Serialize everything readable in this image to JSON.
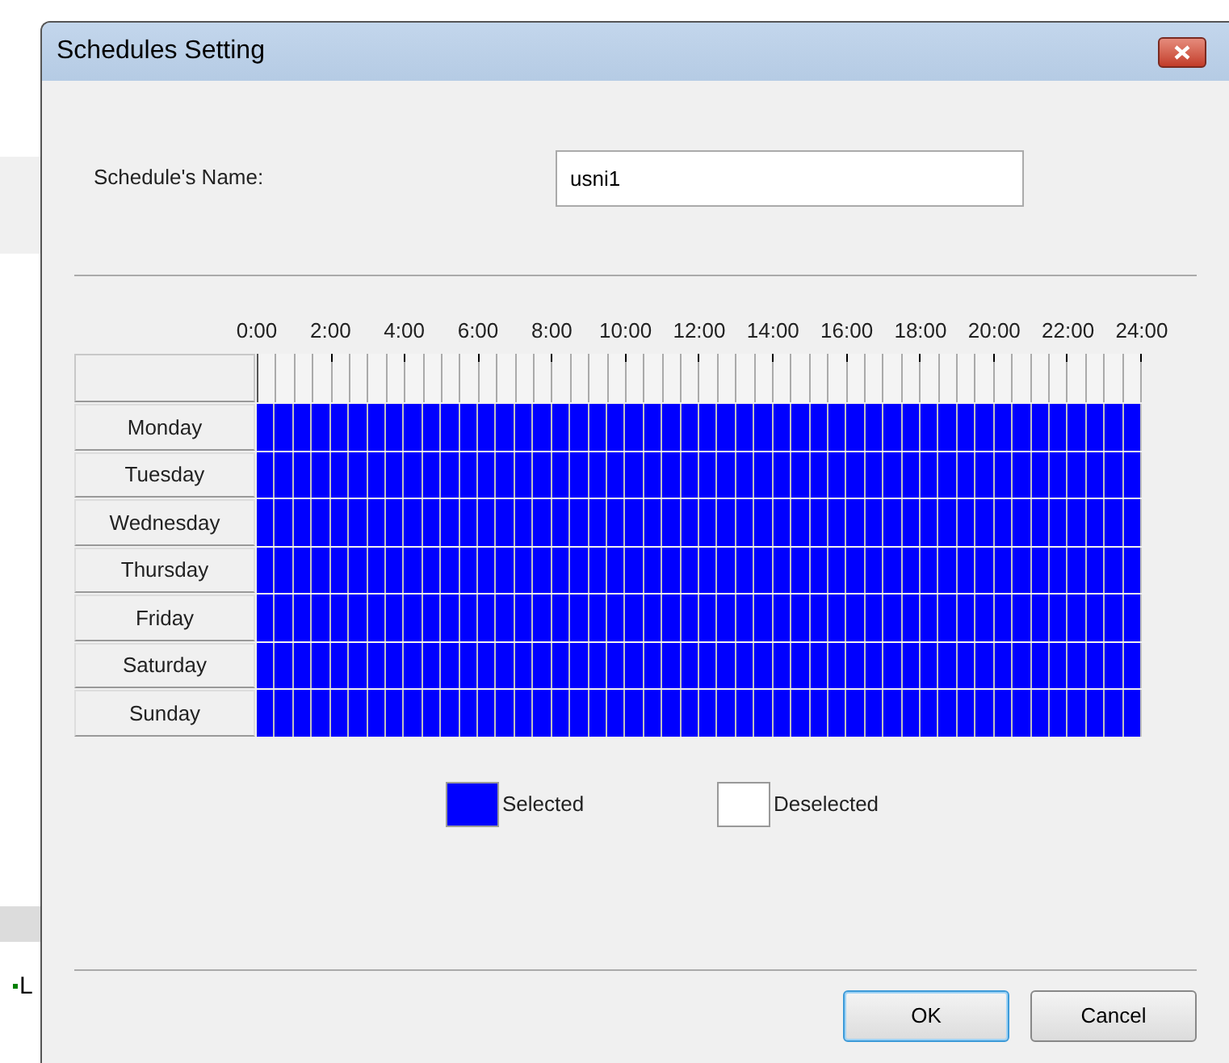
{
  "background": {
    "fragment": "L"
  },
  "window": {
    "title": "Schedules Setting"
  },
  "name_field": {
    "label": "Schedule's Name:",
    "value": "usni1"
  },
  "hours": [
    "0:00",
    "2:00",
    "4:00",
    "6:00",
    "8:00",
    "10:00",
    "12:00",
    "14:00",
    "16:00",
    "18:00",
    "20:00",
    "22:00",
    "24:00"
  ],
  "days": [
    {
      "label": "Monday",
      "slots": [
        true,
        true,
        true,
        true,
        true,
        true,
        true,
        true,
        true,
        true,
        true,
        true,
        true,
        true,
        true,
        true,
        true,
        true,
        true,
        true,
        true,
        true,
        true,
        true,
        true,
        true,
        true,
        true,
        true,
        true,
        true,
        true,
        true,
        true,
        true,
        true,
        true,
        true,
        true,
        true,
        true,
        true,
        true,
        true,
        true,
        true,
        true,
        true
      ]
    },
    {
      "label": "Tuesday",
      "slots": [
        true,
        true,
        true,
        true,
        true,
        true,
        true,
        true,
        true,
        true,
        true,
        true,
        true,
        true,
        true,
        true,
        true,
        true,
        true,
        true,
        true,
        true,
        true,
        true,
        true,
        true,
        true,
        true,
        true,
        true,
        true,
        true,
        true,
        true,
        true,
        true,
        true,
        true,
        true,
        true,
        true,
        true,
        true,
        true,
        true,
        true,
        true,
        true
      ]
    },
    {
      "label": "Wednesday",
      "slots": [
        true,
        true,
        true,
        true,
        true,
        true,
        true,
        true,
        true,
        true,
        true,
        true,
        true,
        true,
        true,
        true,
        true,
        true,
        true,
        true,
        true,
        true,
        true,
        true,
        true,
        true,
        true,
        true,
        true,
        true,
        true,
        true,
        true,
        true,
        true,
        true,
        true,
        true,
        true,
        true,
        true,
        true,
        true,
        true,
        true,
        true,
        true,
        true
      ]
    },
    {
      "label": "Thursday",
      "slots": [
        true,
        true,
        true,
        true,
        true,
        true,
        true,
        true,
        true,
        true,
        true,
        true,
        true,
        true,
        true,
        true,
        true,
        true,
        true,
        true,
        true,
        true,
        true,
        true,
        true,
        true,
        true,
        true,
        true,
        true,
        true,
        true,
        true,
        true,
        true,
        true,
        true,
        true,
        true,
        true,
        true,
        true,
        true,
        true,
        true,
        true,
        true,
        true
      ]
    },
    {
      "label": "Friday",
      "slots": [
        true,
        true,
        true,
        true,
        true,
        true,
        true,
        true,
        true,
        true,
        true,
        true,
        true,
        true,
        true,
        true,
        true,
        true,
        true,
        true,
        true,
        true,
        true,
        true,
        true,
        true,
        true,
        true,
        true,
        true,
        true,
        true,
        true,
        true,
        true,
        true,
        true,
        true,
        true,
        true,
        true,
        true,
        true,
        true,
        true,
        true,
        true,
        true
      ]
    },
    {
      "label": "Saturday",
      "slots": [
        true,
        true,
        true,
        true,
        true,
        true,
        true,
        true,
        true,
        true,
        true,
        true,
        true,
        true,
        true,
        true,
        true,
        true,
        true,
        true,
        true,
        true,
        true,
        true,
        true,
        true,
        true,
        true,
        true,
        true,
        true,
        true,
        true,
        true,
        true,
        true,
        true,
        true,
        true,
        true,
        true,
        true,
        true,
        true,
        true,
        true,
        true,
        true
      ]
    },
    {
      "label": "Sunday",
      "slots": [
        true,
        true,
        true,
        true,
        true,
        true,
        true,
        true,
        true,
        true,
        true,
        true,
        true,
        true,
        true,
        true,
        true,
        true,
        true,
        true,
        true,
        true,
        true,
        true,
        true,
        true,
        true,
        true,
        true,
        true,
        true,
        true,
        true,
        true,
        true,
        true,
        true,
        true,
        true,
        true,
        true,
        true,
        true,
        true,
        true,
        true,
        true,
        true
      ]
    }
  ],
  "legend": [
    {
      "label": "Selected",
      "selected": true
    },
    {
      "label": "Deselected",
      "selected": false
    }
  ],
  "buttons": [
    {
      "label": "OK",
      "default": true
    },
    {
      "label": "Cancel",
      "default": false
    }
  ]
}
